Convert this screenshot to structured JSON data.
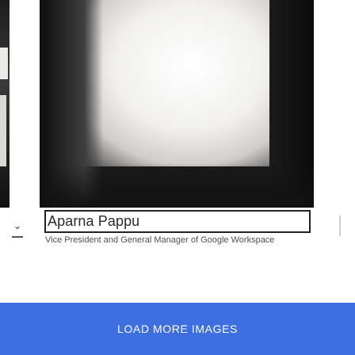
{
  "gallery": {
    "caption": {
      "name": "Aparna Pappu",
      "title": "Vice President and General Manager of Google Workspace"
    },
    "nav": {
      "prev_icon": "chevron-down-icon"
    }
  },
  "actions": {
    "load_more_label": "LOAD MORE IMAGES"
  },
  "colors": {
    "button_bg": "#3d6fe0",
    "button_text": "#ffffff",
    "caption_border": "#222222"
  }
}
